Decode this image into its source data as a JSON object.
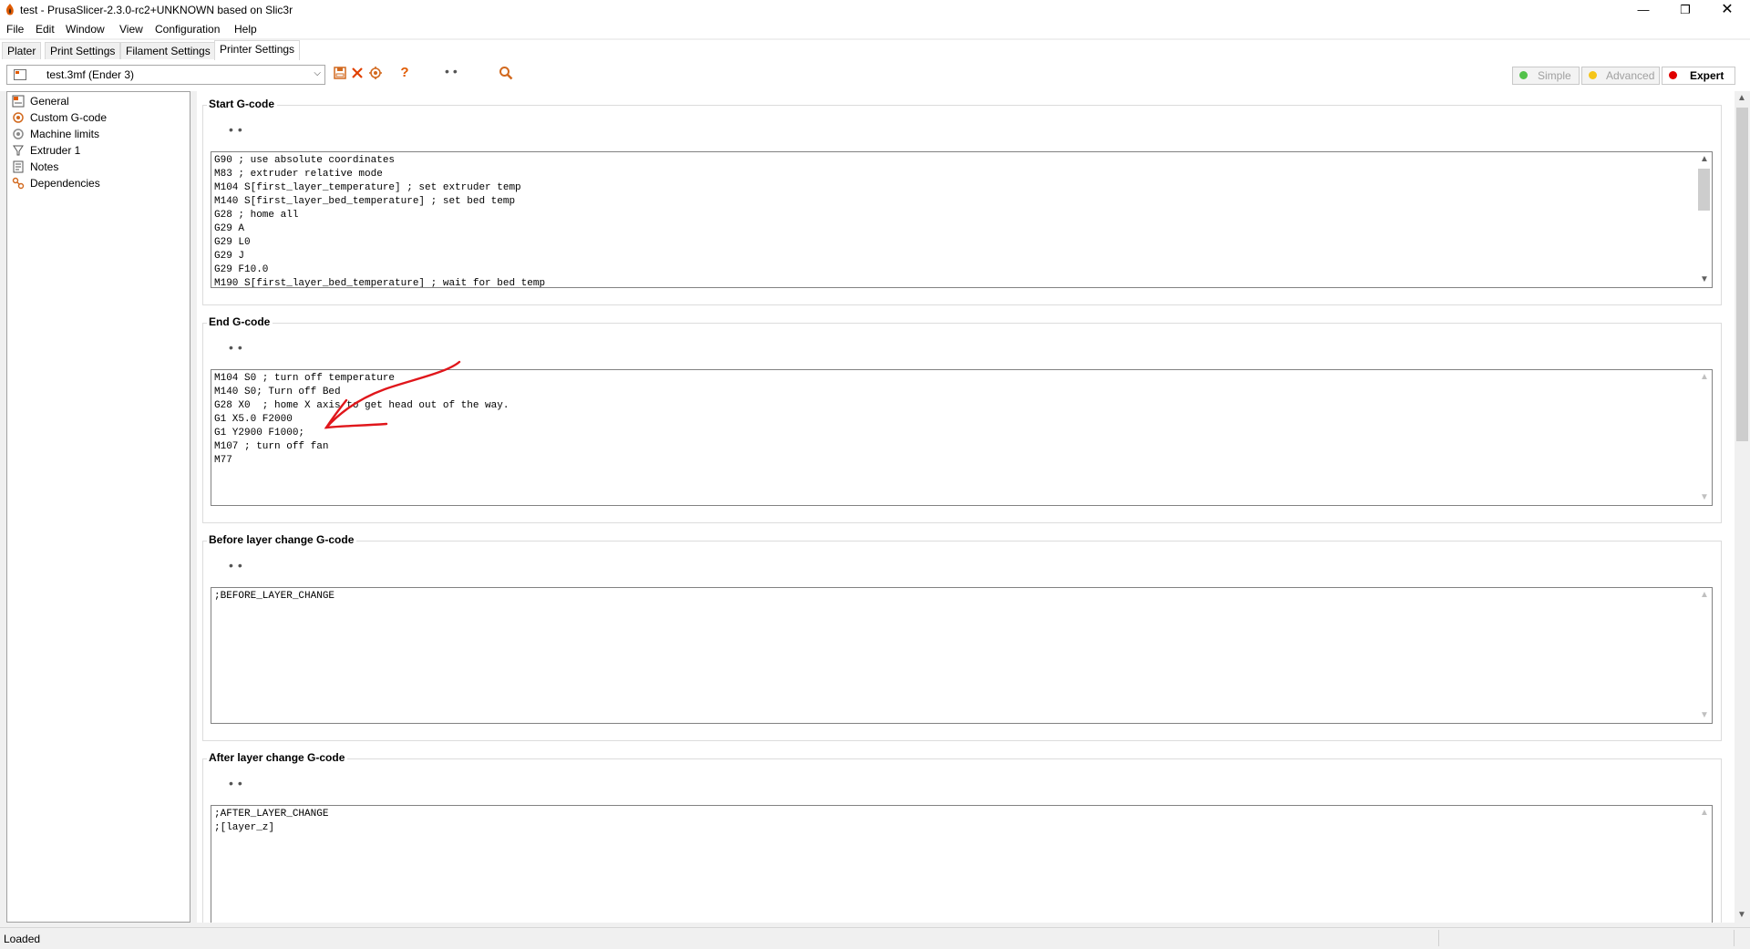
{
  "window": {
    "title": "test - PrusaSlicer-2.3.0-rc2+UNKNOWN based on Slic3r",
    "minimize_glyph": "—",
    "maximize_glyph": "❐",
    "close_glyph": "✕"
  },
  "menu": [
    "File",
    "Edit",
    "Window",
    "View",
    "Configuration",
    "Help"
  ],
  "tabs": [
    {
      "label": "Plater",
      "active": false
    },
    {
      "label": "Print Settings",
      "active": false
    },
    {
      "label": "Filament Settings",
      "active": false
    },
    {
      "label": "Printer Settings",
      "active": true
    }
  ],
  "toolbar": {
    "preset": "test.3mf (Ender 3)",
    "dropdown_glyph": "⌵",
    "save_icon": "save-icon",
    "delete_icon": "delete-icon",
    "compare_icon": "compare-icon",
    "help_glyph": "?",
    "dots": "••",
    "search_glyph": "🔍"
  },
  "modes": [
    {
      "label": "Simple",
      "color": "#52c24a",
      "active": false
    },
    {
      "label": "Advanced",
      "color": "#f5c518",
      "active": false
    },
    {
      "label": "Expert",
      "color": "#e00000",
      "active": true
    }
  ],
  "sidebar": [
    {
      "label": "General",
      "icon": "printer-icon"
    },
    {
      "label": "Custom G-code",
      "icon": "gcode-icon"
    },
    {
      "label": "Machine limits",
      "icon": "cog-icon"
    },
    {
      "label": "Extruder 1",
      "icon": "extruder-icon"
    },
    {
      "label": "Notes",
      "icon": "notes-icon"
    },
    {
      "label": "Dependencies",
      "icon": "dependencies-icon"
    }
  ],
  "sections": [
    {
      "title": "Start G-code",
      "dots": "••",
      "lines": [
        "G90 ; use absolute coordinates",
        "M83 ; extruder relative mode",
        "M104 S[first_layer_temperature] ; set extruder temp",
        "M140 S[first_layer_bed_temperature] ; set bed temp",
        "G28 ; home all",
        "G29 A",
        "G29 L0",
        "G29 J",
        "G29 F10.0",
        "M190 S[first_layer_bed_temperature] ; wait for bed temp"
      ]
    },
    {
      "title": "End G-code",
      "dots": "••",
      "lines": [
        "M104 S0 ; turn off temperature",
        "M140 S0; Turn off Bed",
        "G28 X0  ; home X axis to get head out of the way.",
        "G1 X5.0 F2000",
        "G1 Y2900 F1000;",
        "M107 ; turn off fan",
        "M77"
      ]
    },
    {
      "title": "Before layer change G-code",
      "dots": "••",
      "lines": [
        ";BEFORE_LAYER_CHANGE"
      ]
    },
    {
      "title": "After layer change G-code",
      "dots": "••",
      "lines": [
        ";AFTER_LAYER_CHANGE",
        ";[layer_z]"
      ]
    }
  ],
  "scroll_arrows": {
    "up": "▲",
    "down": "▼"
  },
  "status": "Loaded",
  "annotation_color": "#e0161b"
}
